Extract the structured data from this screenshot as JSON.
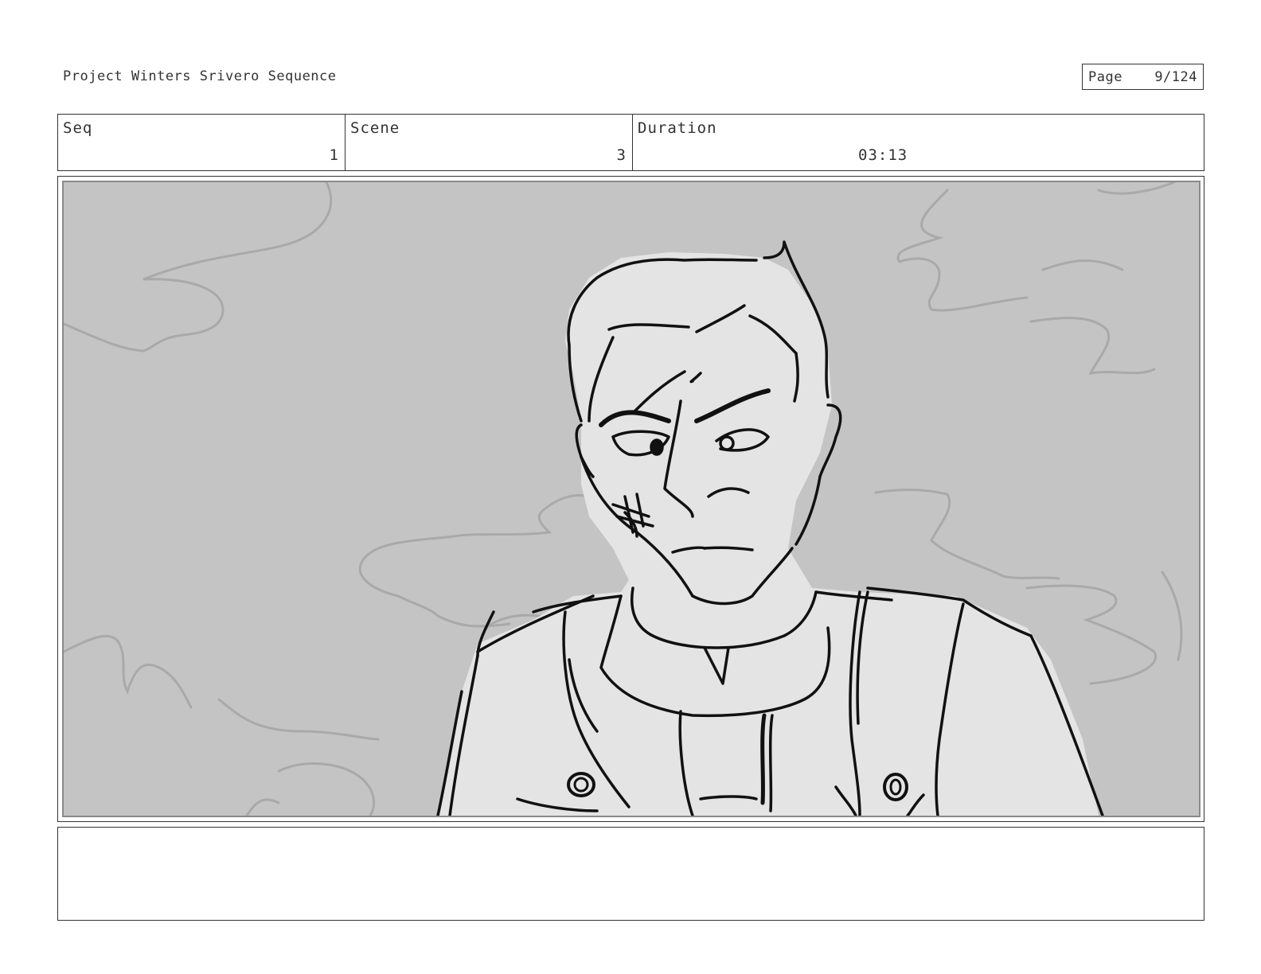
{
  "header": {
    "project_title": "Project Winters Srivero Sequence",
    "page_label": "Page",
    "page_value": "9/124"
  },
  "info": {
    "seq_label": "Seq",
    "seq_value": "1",
    "scene_label": "Scene",
    "scene_value": "3",
    "duration_label": "Duration",
    "duration_value": "03:13"
  },
  "panel": {
    "background_color": "#c4c4c4",
    "figure_fill": "#e4e4e4",
    "line_color": "#111111"
  },
  "notes": {
    "text": ""
  }
}
